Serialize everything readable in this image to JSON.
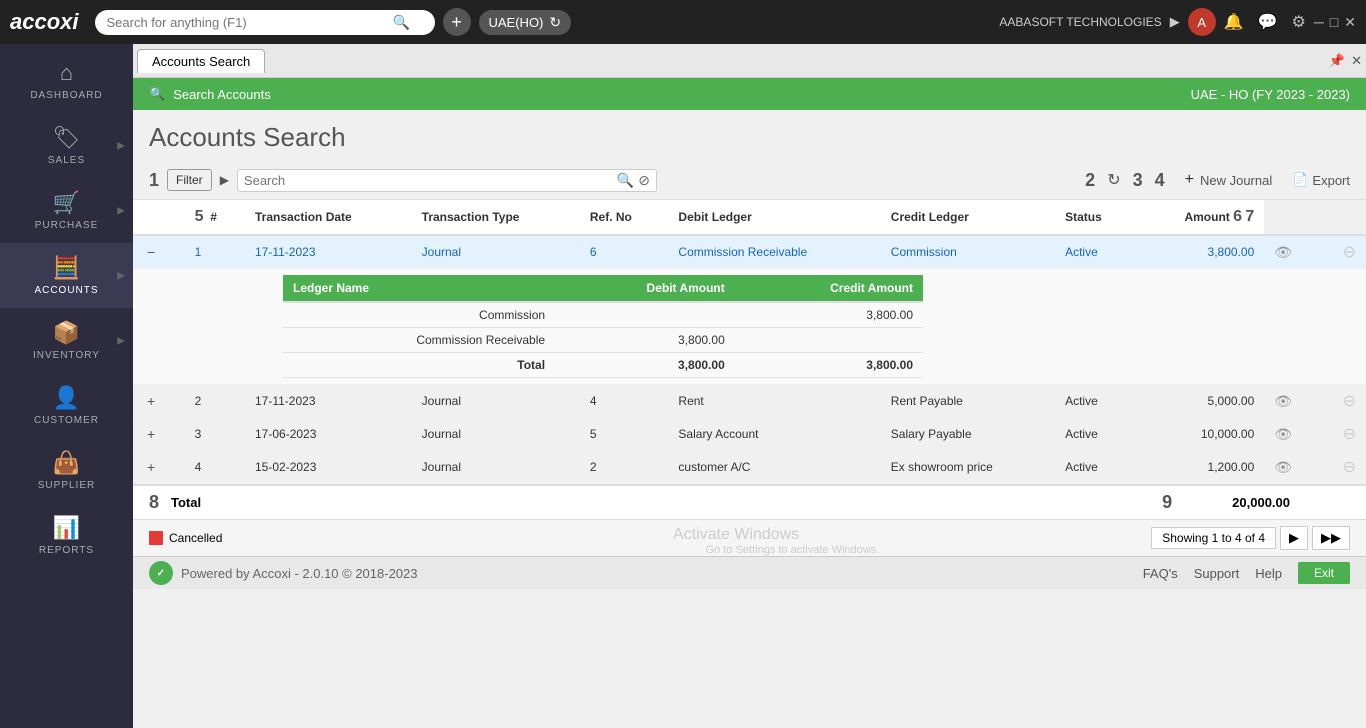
{
  "topbar": {
    "logo": "accoxi",
    "search_placeholder": "Search for anything (F1)",
    "company": "UAE(HO)",
    "company_name": "AABASOFT TECHNOLOGIES",
    "user_initials": "A"
  },
  "sidebar": {
    "items": [
      {
        "label": "DASHBOARD",
        "icon": "⌂"
      },
      {
        "label": "SALES",
        "icon": "🏷"
      },
      {
        "label": "PURCHASE",
        "icon": "🛒"
      },
      {
        "label": "ACCOUNTS",
        "icon": "🧮"
      },
      {
        "label": "INVENTORY",
        "icon": "📦"
      },
      {
        "label": "CUSTOMER",
        "icon": "👤"
      },
      {
        "label": "SUPPLIER",
        "icon": "👜"
      },
      {
        "label": "REPORTS",
        "icon": "📊"
      }
    ]
  },
  "tab": {
    "label": "Accounts Search"
  },
  "section_header": {
    "left": "Search Accounts",
    "right": "UAE - HO (FY 2023 - 2023)"
  },
  "page_title": "Accounts Search",
  "toolbar": {
    "num1": "1",
    "filter_label": "Filter",
    "search_placeholder": "Search",
    "num2": "2",
    "num3": "3",
    "num4": "4",
    "new_journal_label": "New Journal",
    "export_label": "Export"
  },
  "table": {
    "columns": [
      "#",
      "Transaction Date",
      "Transaction Type",
      "Ref. No",
      "Debit Ledger",
      "Credit Ledger",
      "Status",
      "Amount",
      "",
      ""
    ],
    "rows": [
      {
        "id": "1",
        "date": "17-11-2023",
        "type": "Journal",
        "ref": "6",
        "debit": "Commission Receivable",
        "credit": "Commission",
        "status": "Active",
        "amount": "3,800.00",
        "expanded": true
      },
      {
        "id": "2",
        "date": "17-11-2023",
        "type": "Journal",
        "ref": "4",
        "debit": "Rent",
        "credit": "Rent Payable",
        "status": "Active",
        "amount": "5,000.00",
        "expanded": false
      },
      {
        "id": "3",
        "date": "17-06-2023",
        "type": "Journal",
        "ref": "5",
        "debit": "Salary Account",
        "credit": "Salary Payable",
        "status": "Active",
        "amount": "10,000.00",
        "expanded": false
      },
      {
        "id": "4",
        "date": "15-02-2023",
        "type": "Journal",
        "ref": "2",
        "debit": "customer A/C",
        "credit": "Ex showroom price",
        "status": "Active",
        "amount": "1,200.00",
        "expanded": false
      }
    ],
    "sub_table": {
      "columns": [
        "Ledger Name",
        "Debit Amount",
        "Credit Amount"
      ],
      "rows": [
        {
          "ledger": "Commission",
          "debit": "",
          "credit": "3,800.00"
        },
        {
          "ledger": "Commission Receivable",
          "debit": "3,800.00",
          "credit": ""
        }
      ],
      "total": {
        "debit": "3,800.00",
        "credit": "3,800.00"
      }
    },
    "footer_total_label": "Total",
    "footer_total_amount": "20,000.00"
  },
  "pagination": {
    "info": "Showing 1 to 4 of 4"
  },
  "legend": {
    "cancelled_label": "Cancelled"
  },
  "powered": {
    "text": "Powered by Accoxi - 2.0.10 © 2018-2023",
    "links": [
      "FAQ's",
      "Support",
      "Help"
    ],
    "exit": "Exit"
  },
  "num_labels": {
    "n5": "5",
    "n6": "6",
    "n7": "7",
    "n8": "8",
    "n9": "9"
  }
}
